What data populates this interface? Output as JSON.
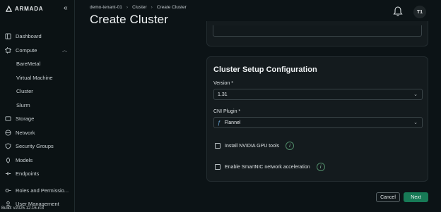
{
  "brand": {
    "name": "ARMADA",
    "accent": "#177a56"
  },
  "sidebar": {
    "collapse_icon": "double-chevron-left-icon",
    "items": [
      {
        "label": "Dashboard",
        "icon": "dashboard-icon"
      },
      {
        "label": "Compute",
        "icon": "compute-icon",
        "expanded": true
      },
      {
        "label": "BareMetal",
        "sub": true
      },
      {
        "label": "Virtual Machine",
        "sub": true
      },
      {
        "label": "Cluster",
        "sub": true
      },
      {
        "label": "Slurm",
        "sub": true
      },
      {
        "label": "Storage",
        "icon": "storage-icon"
      },
      {
        "label": "Network",
        "icon": "network-icon"
      },
      {
        "label": "Security Groups",
        "icon": "shield-icon"
      },
      {
        "label": "Models",
        "icon": "models-icon"
      },
      {
        "label": "Endpoints",
        "icon": "endpoints-icon"
      },
      {
        "label": "Roles and Permissio...",
        "icon": "roles-icon"
      },
      {
        "label": "User Management",
        "icon": "user-icon"
      }
    ],
    "build": "Build: v2025.12.16-rc3"
  },
  "header": {
    "breadcrumb": [
      "demo-tenant-01",
      "Cluster",
      "Create Cluster"
    ],
    "title": "Create Cluster",
    "avatar": "T1"
  },
  "setup": {
    "title": "Cluster Setup Configuration",
    "version_label": "Version *",
    "version_value": "1.31",
    "cni_label": "CNI Plugin *",
    "cni_value": "Flannel",
    "gpu_tools_label": "Install NVIDIA GPU tools",
    "gpu_tools_checked": false,
    "smartnic_label": "Enable SmartNIC network acceleration",
    "smartnic_checked": false
  },
  "actions": {
    "cancel": "Cancel",
    "next": "Next"
  }
}
